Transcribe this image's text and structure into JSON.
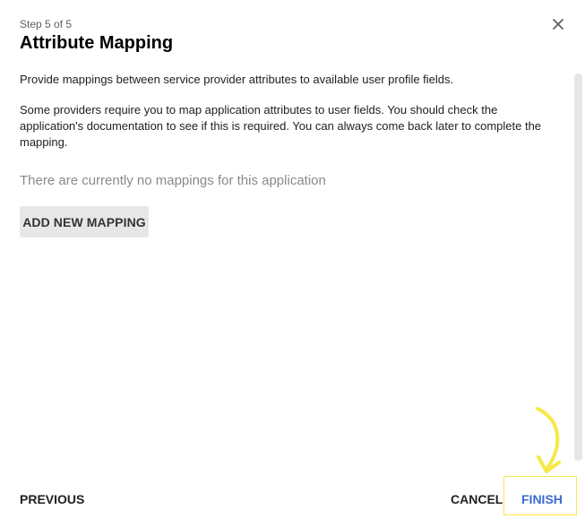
{
  "dialog": {
    "step": "Step 5 of 5",
    "title": "Attribute Mapping",
    "close_icon": "close-icon"
  },
  "content": {
    "description_1": "Provide mappings between service provider attributes to available user profile fields.",
    "description_2": "Some providers require you to map application attributes to user fields. You should check the application's documentation to see if this is required. You can always come back later to complete the mapping.",
    "empty_message": "There are currently no mappings for this application",
    "add_button_label": "ADD NEW MAPPING"
  },
  "footer": {
    "previous_label": "PREVIOUS",
    "cancel_label": "CANCEL",
    "finish_label": "FINISH"
  },
  "colors": {
    "primary": "#3b6bd1",
    "highlight": "#f7e84a",
    "button_bg": "#e7e7e7"
  }
}
